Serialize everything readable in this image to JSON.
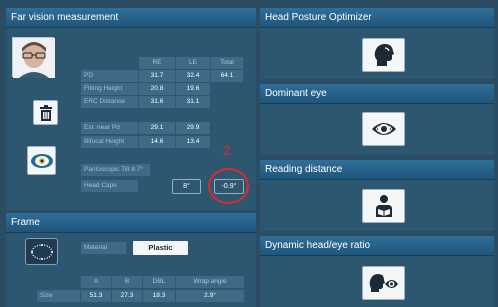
{
  "app": {
    "colors": {
      "header": "#2f6f99",
      "panel": "#2d5670",
      "cell": "#3e6a86",
      "annotation": "#e02a2a"
    }
  },
  "far_vision": {
    "title": "Far vision measurement",
    "columns": [
      "RE",
      "LE",
      "Total"
    ],
    "rows": [
      {
        "label": "PD",
        "re": "31.7",
        "le": "32.4",
        "total": "64.1"
      },
      {
        "label": "Fitting Height",
        "re": "20.8",
        "le": "19.6"
      },
      {
        "label": "ERC Distance",
        "re": "31.6",
        "le": "31.1"
      }
    ],
    "near_rows": [
      {
        "label": "Est. near Pd",
        "re": "29.1",
        "le": "29.9"
      },
      {
        "label": "Bifocal Height",
        "re": "14.6",
        "le": "13.4"
      }
    ],
    "pantoscopic": {
      "label": "Pantoscopic Tilt 8.7°"
    },
    "head_cape": {
      "label": "Head Cape",
      "value_a": "8°",
      "value_b": "-0.9°"
    },
    "icons": {
      "photo": "face-photo",
      "delete": "trash-icon",
      "eye": "eye-icon"
    }
  },
  "annotation": {
    "number": "2"
  },
  "frame": {
    "title": "Frame",
    "material_label": "Material",
    "material_value": "Plastic",
    "columns": [
      "A",
      "B",
      "DBL",
      "Wrap angle"
    ],
    "row_label": "Size",
    "values": [
      "51.3",
      "27.3",
      "18.3",
      "2.9°"
    ]
  },
  "right": {
    "head_posture": {
      "title": "Head Posture Optimizer"
    },
    "dominant_eye": {
      "title": "Dominant eye"
    },
    "reading": {
      "title": "Reading distance"
    },
    "dynamic": {
      "title": "Dynamic head/eye ratio"
    }
  }
}
